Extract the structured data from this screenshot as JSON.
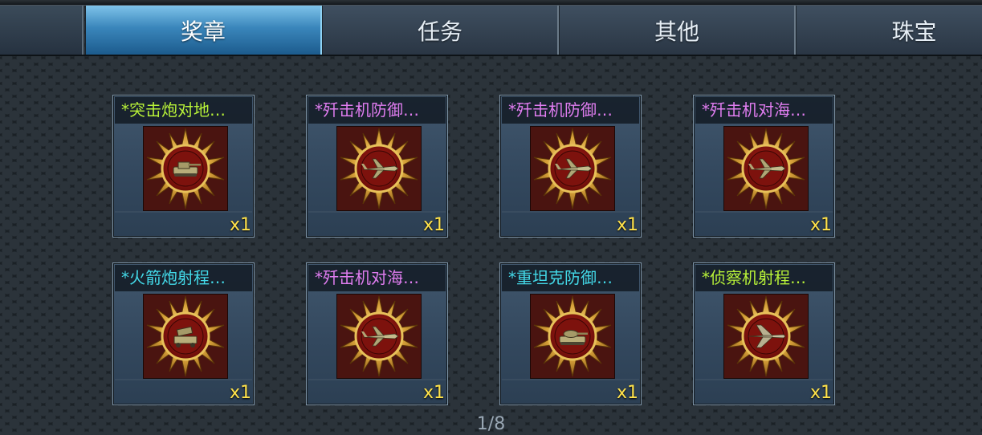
{
  "tabs": [
    {
      "label": "奖章",
      "active": true
    },
    {
      "label": "任务",
      "active": false
    },
    {
      "label": "其他",
      "active": false
    },
    {
      "label": "珠宝",
      "active": false
    }
  ],
  "items": [
    {
      "name": "*突击炮对地…",
      "qty": "x1",
      "name_color": "#b8f238",
      "emblem": "assault-gun-icon"
    },
    {
      "name": "*歼击机防御…",
      "qty": "x1",
      "name_color": "#e07df0",
      "emblem": "fighter-jet-icon"
    },
    {
      "name": "*歼击机防御…",
      "qty": "x1",
      "name_color": "#e07df0",
      "emblem": "fighter-jet-icon"
    },
    {
      "name": "*歼击机对海…",
      "qty": "x1",
      "name_color": "#e07df0",
      "emblem": "fighter-jet-icon"
    },
    {
      "name": "*火箭炮射程…",
      "qty": "x1",
      "name_color": "#43d9e8",
      "emblem": "rocket-artillery-icon"
    },
    {
      "name": "*歼击机对海…",
      "qty": "x1",
      "name_color": "#e07df0",
      "emblem": "fighter-jet-icon"
    },
    {
      "name": "*重坦克防御…",
      "qty": "x1",
      "name_color": "#43d9e8",
      "emblem": "heavy-tank-icon"
    },
    {
      "name": "*侦察机射程…",
      "qty": "x1",
      "name_color": "#b8f238",
      "emblem": "recon-plane-icon"
    }
  ],
  "pager": "1/8"
}
